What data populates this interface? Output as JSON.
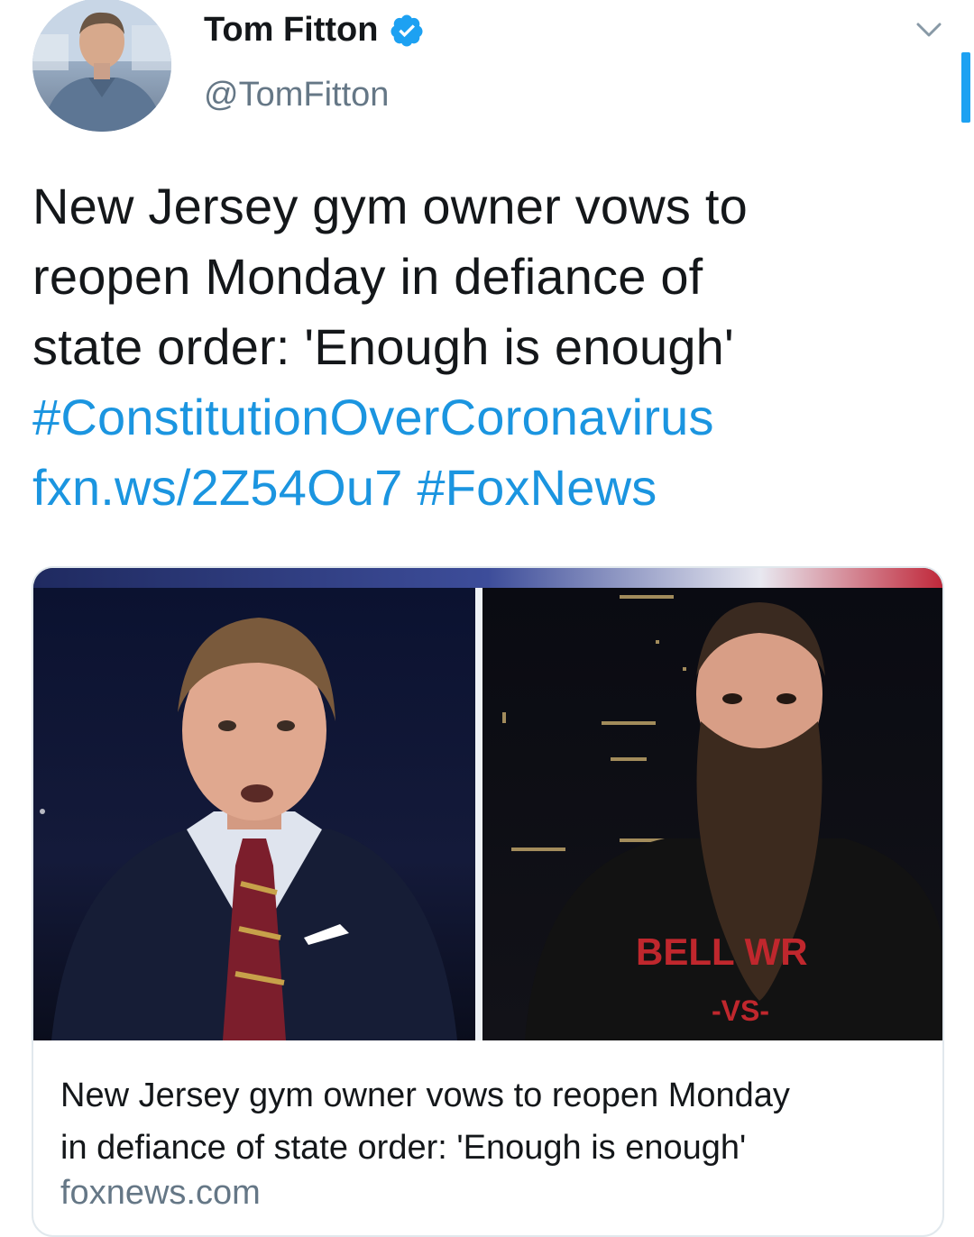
{
  "tweet": {
    "author_name": "Tom Fitton",
    "author_handle": "@TomFitton",
    "text_lines": [
      "New Jersey gym owner vows to",
      "reopen Monday in defiance of",
      "state order: 'Enough is enough'"
    ],
    "hashtag": "#ConstitutionOverCoronavirus",
    "short_link": "fxn.ws/2Z54Ou7",
    "hashtag_source": "#FoxNews"
  },
  "card": {
    "title_lines": [
      "New Jersey gym owner vows to reopen Monday",
      "in defiance of state order: 'Enough is enough'"
    ],
    "domain": "foxnews.com",
    "shirt_text_top": "BELL WR",
    "shirt_text_bottom": "-VS-"
  },
  "icons": {
    "verified": "verified-badge-icon",
    "menu": "chevron-down-icon"
  },
  "colors": {
    "link": "#1b95e0",
    "text": "#14171a",
    "secondary": "#657786",
    "verified": "#1da1f2",
    "card_border": "#e1e8ed"
  }
}
